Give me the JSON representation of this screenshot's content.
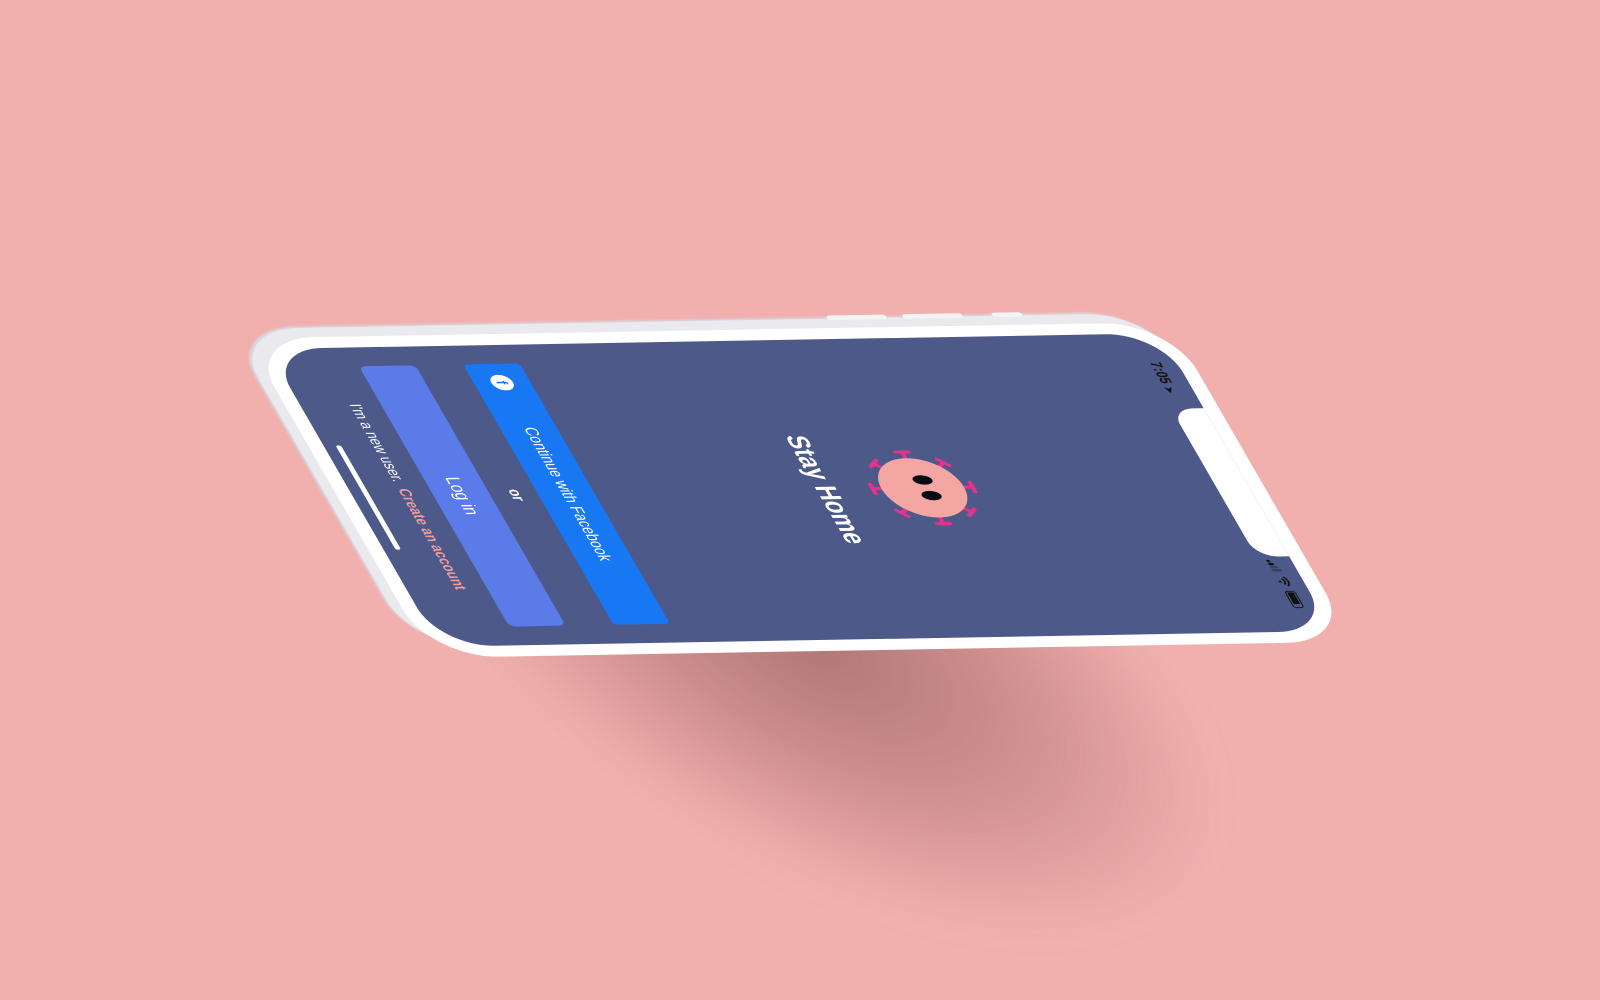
{
  "status_bar": {
    "time": "7:05",
    "location_icon": "location-arrow-icon",
    "icons": [
      "signal-icon",
      "wifi-icon",
      "battery-icon"
    ]
  },
  "app": {
    "title": "Stay Home",
    "mascot_icon": "virus-mascot-icon"
  },
  "buttons": {
    "facebook_label": "Continue with Facebook",
    "facebook_icon_glyph": "f",
    "or_label": "or",
    "login_label": "Log in"
  },
  "signup": {
    "prompt": "I'm a new user.",
    "link": "Create an account"
  },
  "colors": {
    "background": "#f1b0ae",
    "screen": "#4c5989",
    "facebook": "#1877f2",
    "login": "#5b7be9",
    "accent_link": "#f29a98",
    "mascot": "#f4a6a3",
    "mascot_spikes": "#e2348d"
  }
}
